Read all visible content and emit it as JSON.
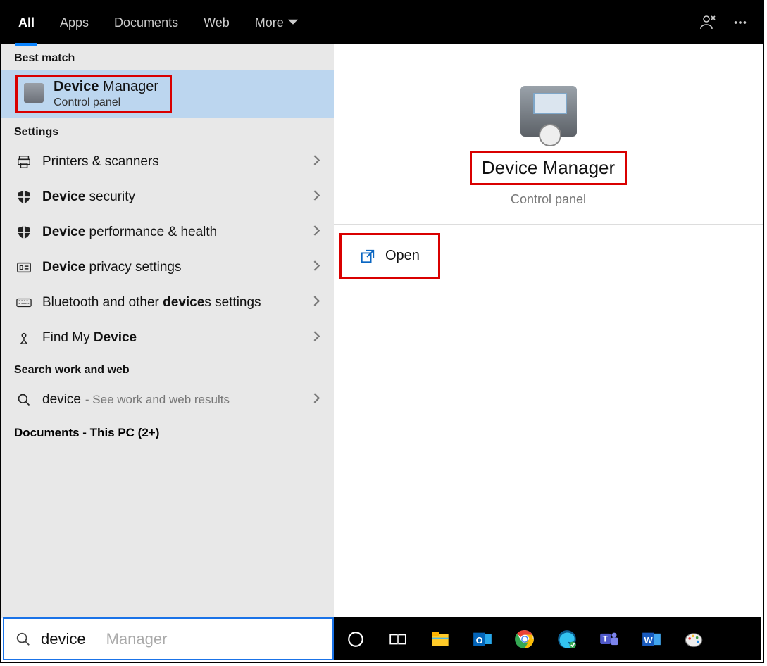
{
  "topbar": {
    "tabs": [
      "All",
      "Apps",
      "Documents",
      "Web"
    ],
    "more_label": "More",
    "active_index": 0
  },
  "left": {
    "best_match_label": "Best match",
    "best_match": {
      "title_bold": "Device",
      "title_rest": " Manager",
      "subtitle": "Control panel"
    },
    "settings_label": "Settings",
    "settings": [
      {
        "icon": "printer-icon",
        "pre": "",
        "bold": "",
        "post": "Printers & scanners"
      },
      {
        "icon": "shield-icon",
        "pre": "",
        "bold": "Device",
        "post": " security"
      },
      {
        "icon": "shield-icon",
        "pre": "",
        "bold": "Device",
        "post": " performance & health"
      },
      {
        "icon": "privacy-icon",
        "pre": "",
        "bold": "Device",
        "post": " privacy settings"
      },
      {
        "icon": "keyboard-icon",
        "pre": "Bluetooth and other ",
        "bold": "device",
        "post": "s settings"
      },
      {
        "icon": "find-device-icon",
        "pre": "Find My ",
        "bold": "Device",
        "post": ""
      }
    ],
    "search_work_label": "Search work and web",
    "search_work": {
      "query": "device",
      "tail": " - See work and web results"
    },
    "documents_label": "Documents - This PC (2+)"
  },
  "right": {
    "title": "Device Manager",
    "subtitle": "Control panel",
    "open_label": "Open"
  },
  "search": {
    "typed": "device",
    "ghost": " Manager"
  }
}
